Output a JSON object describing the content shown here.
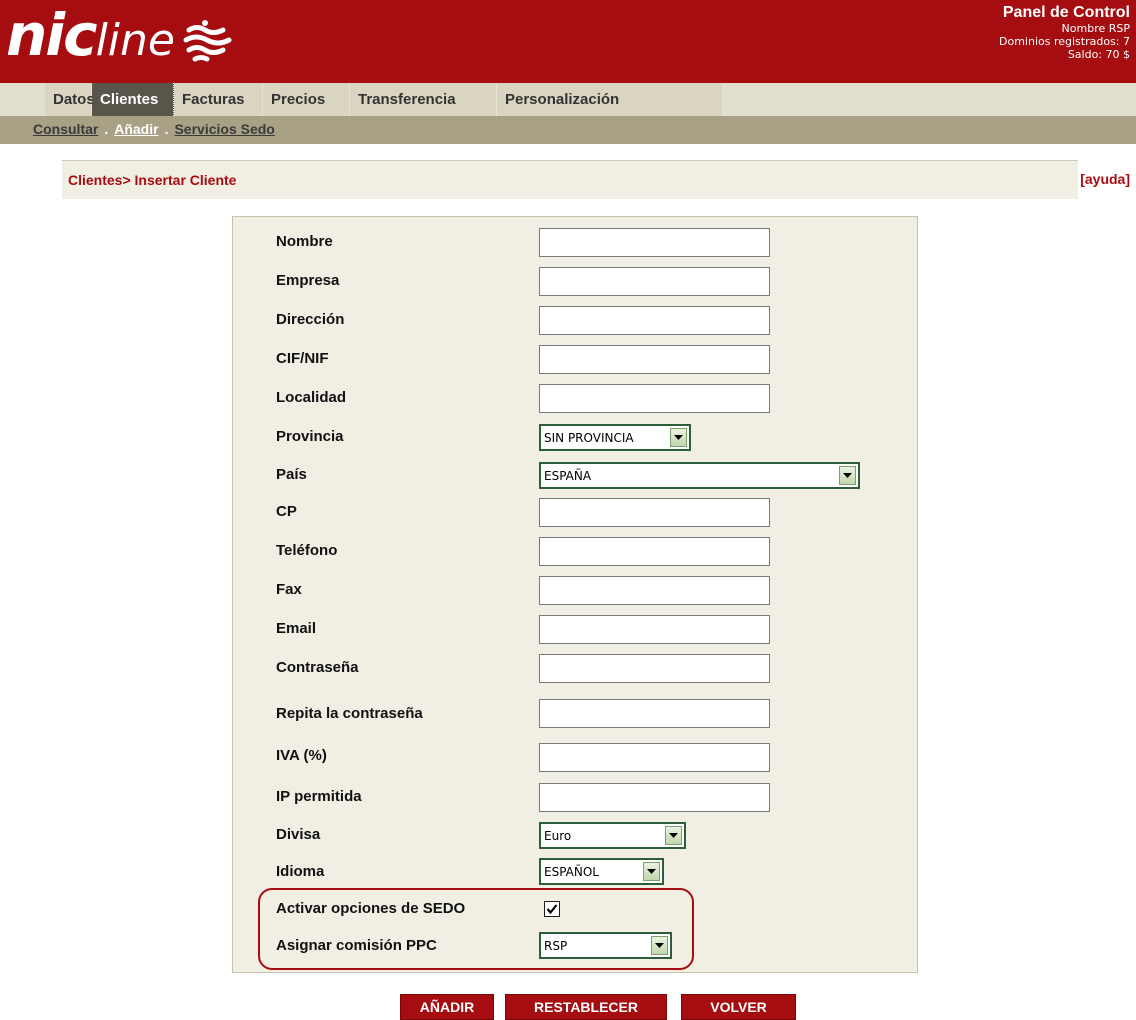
{
  "brand": {
    "logo_main": "nic",
    "logo_rest": "line"
  },
  "panel": {
    "title": "Panel de Control",
    "user": "Nombre RSP",
    "domains": "Dominios registrados: 7",
    "balance": "Saldo: 70 $"
  },
  "menu": {
    "items": [
      {
        "label": "Datos"
      },
      {
        "label": "Clientes",
        "active": true
      },
      {
        "label": "Facturas"
      },
      {
        "label": "Precios"
      },
      {
        "label": "Transferencia"
      },
      {
        "label": "Personalización"
      }
    ]
  },
  "submenu": {
    "items": [
      {
        "label": "Consultar"
      },
      {
        "label": "Añadir",
        "active": true
      },
      {
        "label": "Servicios Sedo"
      }
    ],
    "separator": "."
  },
  "breadcrumb": "Clientes> Insertar Cliente",
  "help": "[ayuda]",
  "form": {
    "nombre": {
      "label": "Nombre",
      "value": ""
    },
    "empresa": {
      "label": "Empresa",
      "value": ""
    },
    "direccion": {
      "label": "Dirección",
      "value": ""
    },
    "cif": {
      "label": "CIF/NIF",
      "value": ""
    },
    "localidad": {
      "label": "Localidad",
      "value": ""
    },
    "provincia": {
      "label": "Provincia",
      "value": "SIN PROVINCIA"
    },
    "pais": {
      "label": "País",
      "value": "ESPAÑA"
    },
    "cp": {
      "label": "CP",
      "value": ""
    },
    "telefono": {
      "label": "Teléfono",
      "value": ""
    },
    "fax": {
      "label": "Fax",
      "value": ""
    },
    "email": {
      "label": "Email",
      "value": ""
    },
    "contrasena": {
      "label": "Contraseña",
      "value": ""
    },
    "repita": {
      "label": "Repita la contraseña",
      "value": ""
    },
    "iva": {
      "label": "IVA (%)",
      "value": ""
    },
    "ip": {
      "label": "IP permitida",
      "value": ""
    },
    "divisa": {
      "label": "Divisa",
      "value": "Euro"
    },
    "idioma": {
      "label": "Idioma",
      "value": "ESPAÑOL"
    },
    "sedo": {
      "label": "Activar opciones de SEDO",
      "checked": true
    },
    "ppc": {
      "label": "Asignar comisión PPC",
      "value": "RSP"
    }
  },
  "buttons": {
    "add": "AÑADIR",
    "reset": "RESTABLECER",
    "back": "VOLVER"
  },
  "colors": {
    "brand_red": "#a60d10",
    "menu_bg": "#dad5c0",
    "menu_active": "#59554b",
    "submenu_bg": "#a8a186",
    "form_bg": "#f1eee4",
    "select_border": "#2c5e3c"
  }
}
